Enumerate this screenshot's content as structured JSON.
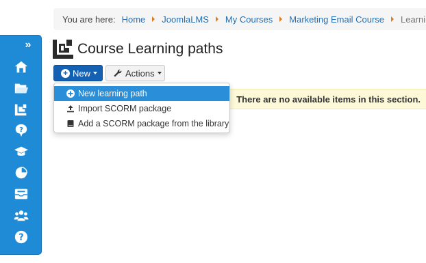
{
  "sidebar": {
    "toggle_glyph": "»",
    "icons": [
      "home-icon",
      "folder-icon",
      "learning-paths-icon",
      "quiz-icon",
      "graduation-cap-icon",
      "reports-pie-icon",
      "mail-icon",
      "users-icon",
      "help-icon"
    ]
  },
  "breadcrumb": {
    "lead": "You are here:",
    "items": [
      "Home",
      "JoomlaLMS",
      "My Courses",
      "Marketing Email Course",
      "Learning Paths"
    ]
  },
  "page": {
    "title": "Course Learning paths"
  },
  "toolbar": {
    "new_label": "New",
    "actions_label": "Actions"
  },
  "dropdown": {
    "items": [
      {
        "label": "New learning path",
        "icon": "plus-circle-icon",
        "active": true
      },
      {
        "label": "Import SCORM package",
        "icon": "upload-icon",
        "active": false
      },
      {
        "label": "Add a SCORM package from the library",
        "icon": "book-icon",
        "active": false
      }
    ]
  },
  "notice": {
    "text": "There are no available items in this section."
  },
  "colors": {
    "sidebar": "#1f8ad6",
    "primary_button": "#1461b4",
    "link": "#2a6fae",
    "breadcrumb_separator": "#e07a22",
    "dropdown_active": "#2b8ed8",
    "notice_bg": "#fcf8d8"
  }
}
